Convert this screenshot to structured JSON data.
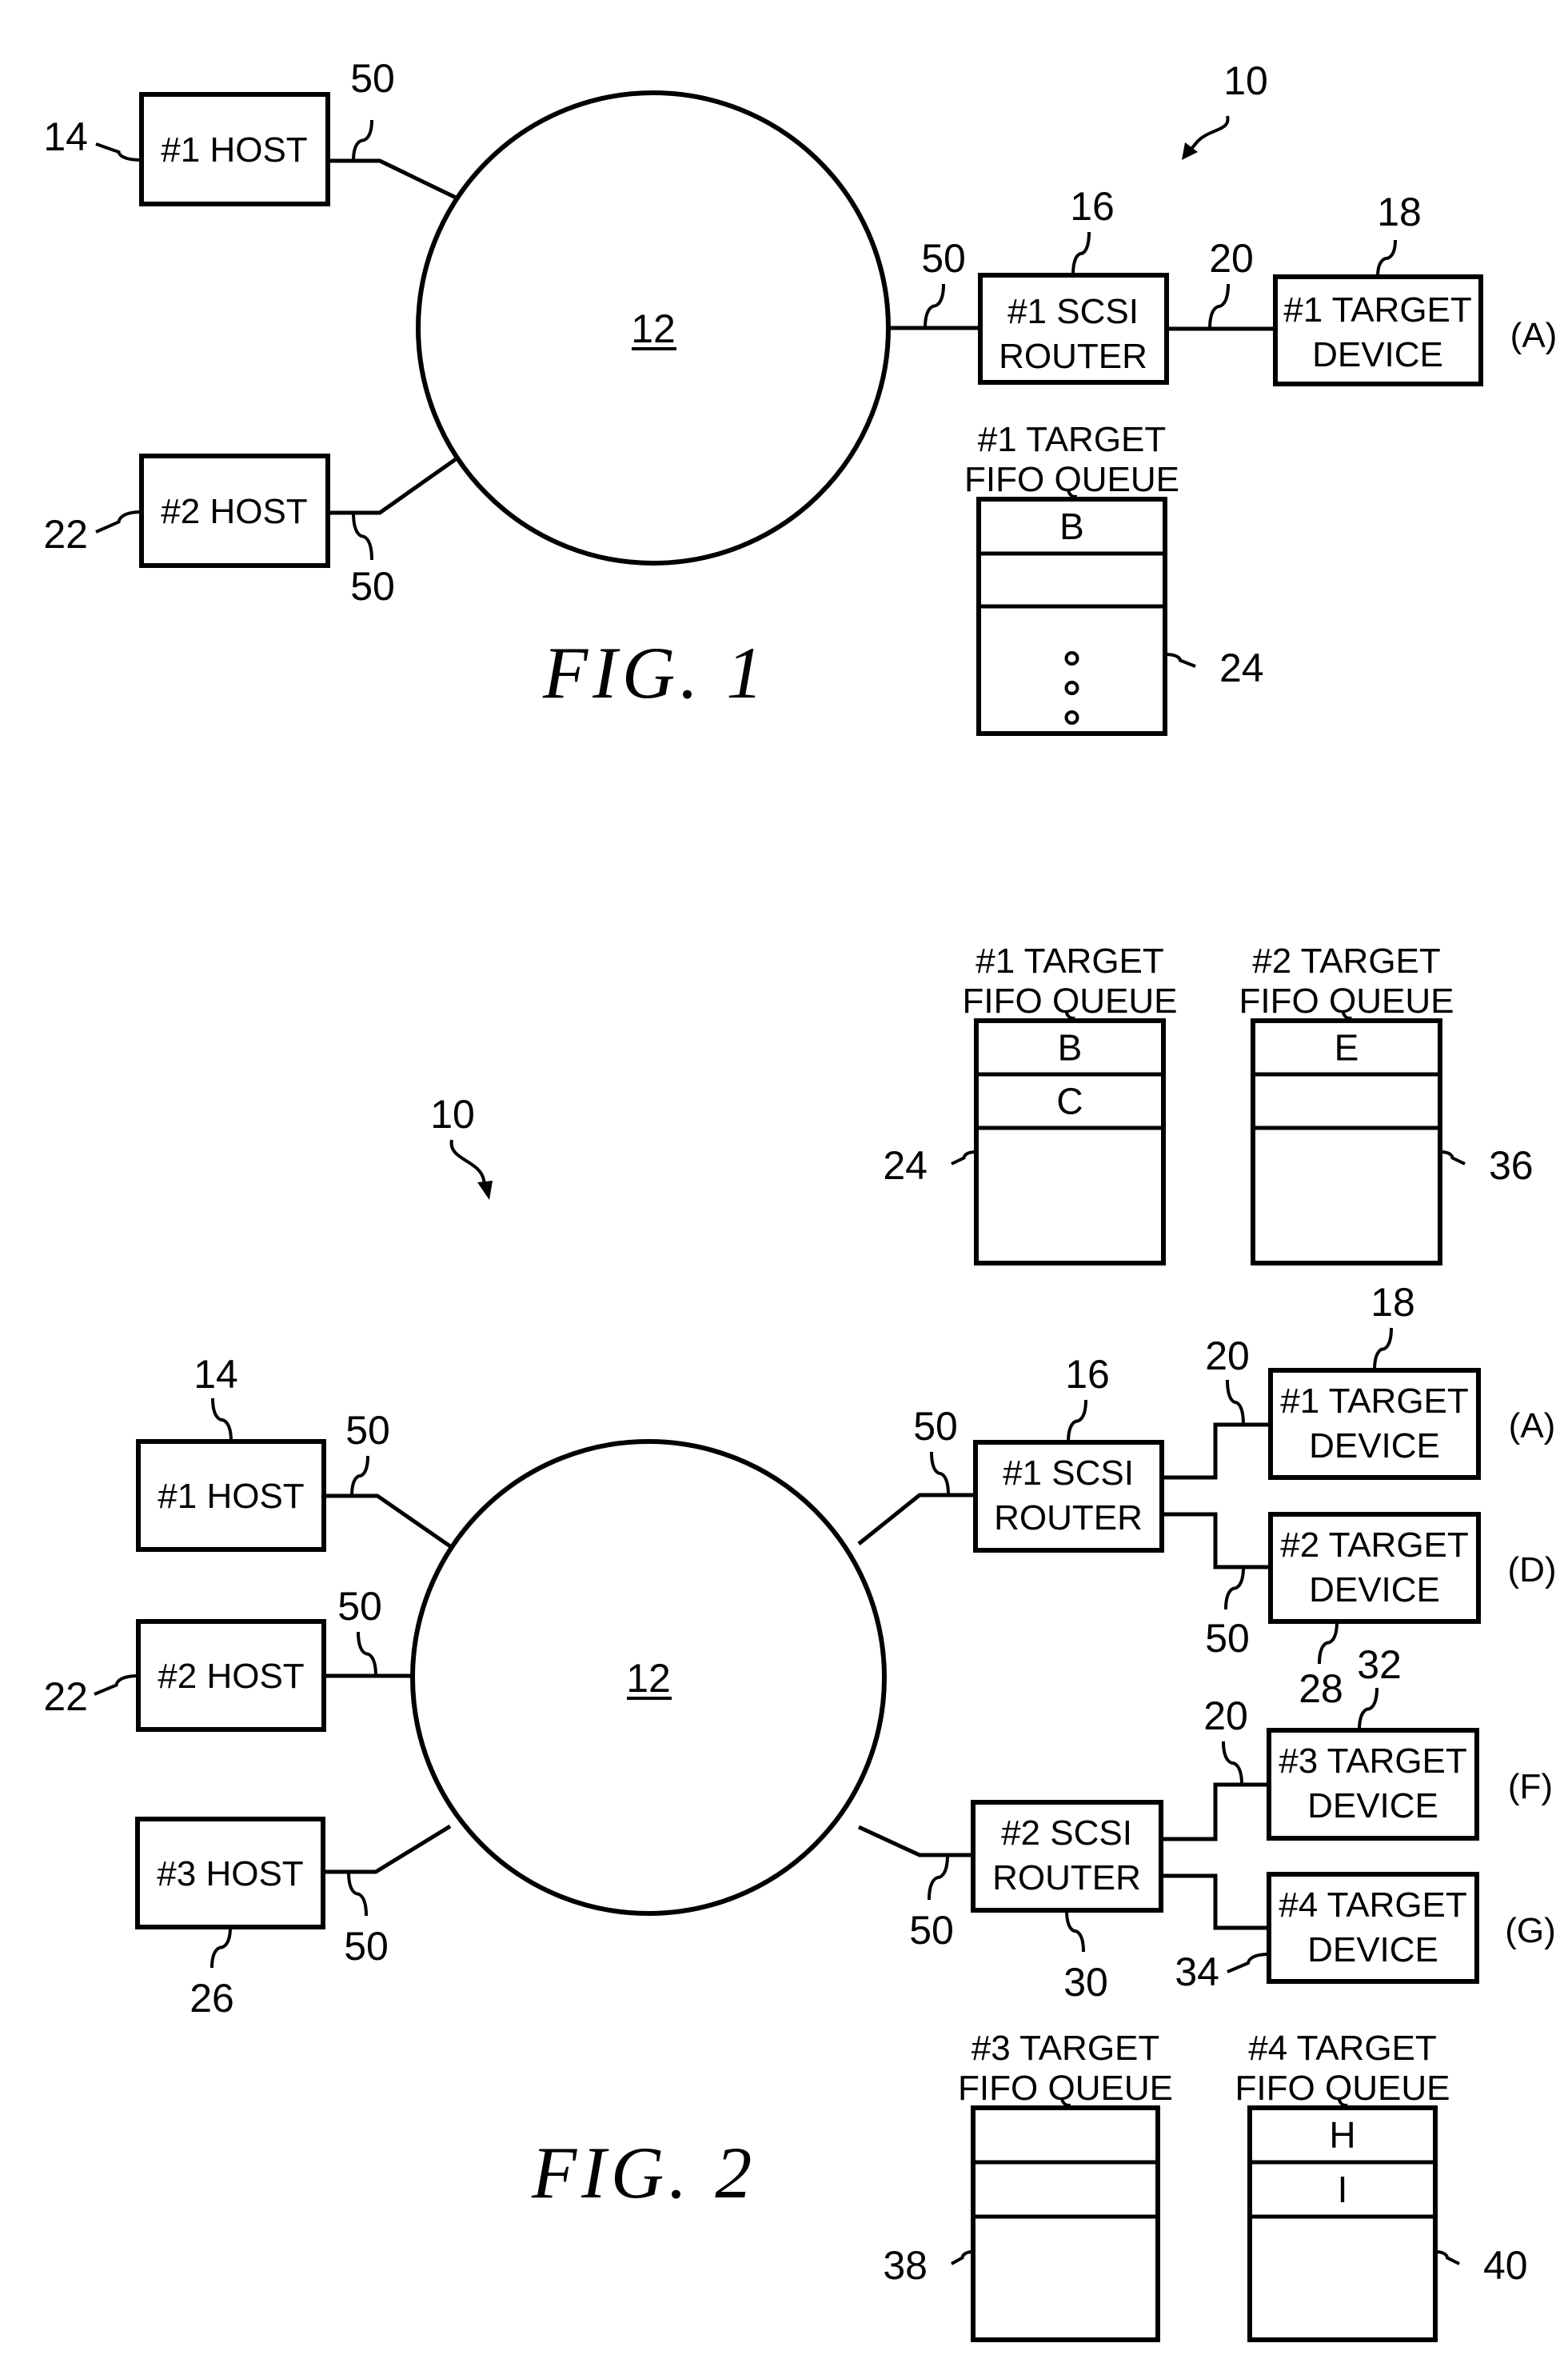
{
  "document": {
    "type": "patent drawing sheet",
    "figures": [
      {
        "id": "fig1",
        "caption": "FIG. 1",
        "system_ref": "10",
        "network": {
          "ref": "12",
          "label": "12"
        },
        "hosts": [
          {
            "ref": "14",
            "label": "#1 HOST",
            "link_ref": "50"
          },
          {
            "ref": "22",
            "label": "#2 HOST",
            "link_ref": "50"
          }
        ],
        "routers": [
          {
            "ref": "16",
            "line1": "#1 SCSI",
            "line2": "ROUTER",
            "link_ref": "50"
          }
        ],
        "targets": [
          {
            "ref": "18",
            "line1": "#1 TARGET",
            "line2": "DEVICE",
            "tag": "(A)",
            "bus_ref": "20"
          }
        ],
        "queues": [
          {
            "ref": "24",
            "line1": "#1 TARGET",
            "line2": "FIFO QUEUE",
            "slots": [
              "B",
              ""
            ],
            "ellipsis": true
          }
        ]
      },
      {
        "id": "fig2",
        "caption": "FIG. 2",
        "system_ref": "10",
        "network": {
          "ref": "12",
          "label": "12"
        },
        "hosts": [
          {
            "ref": "14",
            "label": "#1 HOST",
            "link_ref": "50"
          },
          {
            "ref": "22",
            "label": "#2 HOST",
            "link_ref": "50"
          },
          {
            "ref": "26",
            "label": "#3 HOST",
            "link_ref": "50"
          }
        ],
        "routers": [
          {
            "ref": "16",
            "line1": "#1 SCSI",
            "line2": "ROUTER",
            "link_ref": "50"
          },
          {
            "ref": "30",
            "line1": "#2 SCSI",
            "line2": "ROUTER",
            "link_ref": "50"
          }
        ],
        "targets": [
          {
            "ref": "18",
            "line1": "#1 TARGET",
            "line2": "DEVICE",
            "tag": "(A)",
            "bus_ref": "20"
          },
          {
            "ref": "28",
            "line1": "#2 TARGET",
            "line2": "DEVICE",
            "tag": "(D)",
            "bus_ref": "20"
          },
          {
            "ref": "32",
            "line1": "#3 TARGET",
            "line2": "DEVICE",
            "tag": "(F)",
            "bus_ref": "20"
          },
          {
            "ref": "34",
            "line1": "#4 TARGET",
            "line2": "DEVICE",
            "tag": "(G)",
            "bus_ref": ""
          }
        ],
        "queues": [
          {
            "ref": "24",
            "line1": "#1 TARGET",
            "line2": "FIFO QUEUE",
            "slots": [
              "B",
              "C"
            ],
            "ellipsis": false
          },
          {
            "ref": "36",
            "line1": "#2 TARGET",
            "line2": "FIFO QUEUE",
            "slots": [
              "E",
              ""
            ],
            "ellipsis": false
          },
          {
            "ref": "38",
            "line1": "#3 TARGET",
            "line2": "FIFO QUEUE",
            "slots": [
              "",
              ""
            ],
            "ellipsis": false
          },
          {
            "ref": "40",
            "line1": "#4 TARGET",
            "line2": "FIFO QUEUE",
            "slots": [
              "H",
              "I"
            ],
            "ellipsis": false
          }
        ]
      }
    ]
  }
}
